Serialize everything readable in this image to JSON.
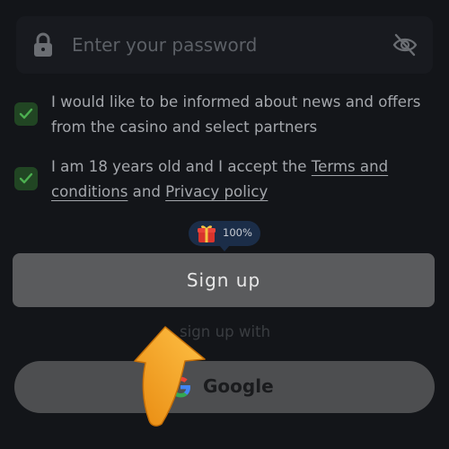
{
  "password": {
    "placeholder": "Enter your password",
    "value": ""
  },
  "consent": {
    "news": {
      "checked": true,
      "text": "I would like to be informed about news and offers from the casino and select partners"
    },
    "age": {
      "checked": true,
      "prefix": "I am 18 years old and I accept the ",
      "terms_link": "Terms and conditions",
      "joiner": " and ",
      "privacy_link": "Privacy policy"
    }
  },
  "badge": {
    "percent": "100%"
  },
  "signup": {
    "label": "Sign up"
  },
  "social": {
    "divider": "sign up with",
    "google_label": "Google"
  },
  "colors": {
    "background": "#131519",
    "checkbox": "#214523",
    "check": "#4caf50",
    "signup_button": "#5a5b5d",
    "google_button": "#4d4e50",
    "badge": "#1b2d48",
    "arrow": "#f5a623"
  },
  "icons": {
    "field_left": "lock-icon",
    "field_right": "eye-slash-icon",
    "badge": "gift-icon",
    "google": "google-icon",
    "overlay": "curved-arrow-icon"
  }
}
